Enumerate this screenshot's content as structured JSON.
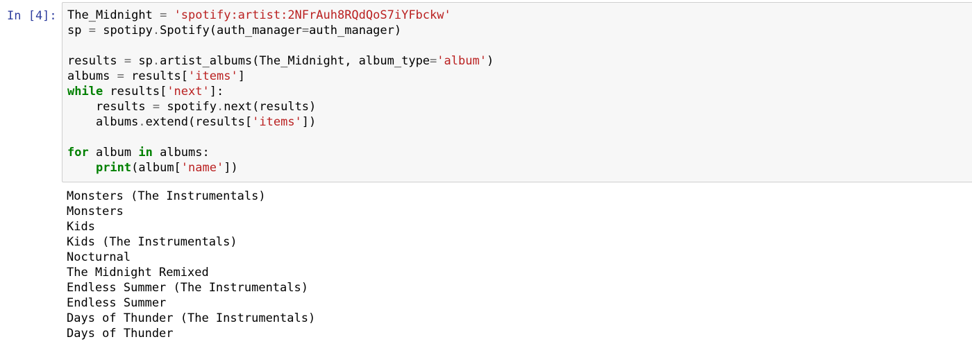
{
  "cell": {
    "prompt": "In [4]:",
    "code_lines": [
      [
        {
          "t": "The_Midnight ",
          "c": ""
        },
        {
          "t": "=",
          "c": "op"
        },
        {
          "t": " ",
          "c": ""
        },
        {
          "t": "'spotify:artist:2NFrAuh8RQdQoS7iYFbckw'",
          "c": "str"
        }
      ],
      [
        {
          "t": "sp ",
          "c": ""
        },
        {
          "t": "=",
          "c": "op"
        },
        {
          "t": " spotipy",
          "c": ""
        },
        {
          "t": ".",
          "c": "op"
        },
        {
          "t": "Spotify(auth_manager",
          "c": ""
        },
        {
          "t": "=",
          "c": "op"
        },
        {
          "t": "auth_manager)",
          "c": ""
        }
      ],
      [],
      [
        {
          "t": "results ",
          "c": ""
        },
        {
          "t": "=",
          "c": "op"
        },
        {
          "t": " sp",
          "c": ""
        },
        {
          "t": ".",
          "c": "op"
        },
        {
          "t": "artist_albums(The_Midnight, album_type",
          "c": ""
        },
        {
          "t": "=",
          "c": "op"
        },
        {
          "t": "'album'",
          "c": "str"
        },
        {
          "t": ")",
          "c": ""
        }
      ],
      [
        {
          "t": "albums ",
          "c": ""
        },
        {
          "t": "=",
          "c": "op"
        },
        {
          "t": " results[",
          "c": ""
        },
        {
          "t": "'items'",
          "c": "str"
        },
        {
          "t": "]",
          "c": ""
        }
      ],
      [
        {
          "t": "while",
          "c": "kw"
        },
        {
          "t": " results[",
          "c": ""
        },
        {
          "t": "'next'",
          "c": "str"
        },
        {
          "t": "]:",
          "c": ""
        }
      ],
      [
        {
          "t": "    results ",
          "c": ""
        },
        {
          "t": "=",
          "c": "op"
        },
        {
          "t": " spotify",
          "c": ""
        },
        {
          "t": ".",
          "c": "op"
        },
        {
          "t": "next(results)",
          "c": ""
        }
      ],
      [
        {
          "t": "    albums",
          "c": ""
        },
        {
          "t": ".",
          "c": "op"
        },
        {
          "t": "extend(results[",
          "c": ""
        },
        {
          "t": "'items'",
          "c": "str"
        },
        {
          "t": "])",
          "c": ""
        }
      ],
      [],
      [
        {
          "t": "for",
          "c": "kw"
        },
        {
          "t": " album ",
          "c": ""
        },
        {
          "t": "in",
          "c": "kw"
        },
        {
          "t": " albums:",
          "c": ""
        }
      ],
      [
        {
          "t": "    ",
          "c": ""
        },
        {
          "t": "print",
          "c": "kw"
        },
        {
          "t": "(album[",
          "c": ""
        },
        {
          "t": "'name'",
          "c": "str"
        },
        {
          "t": "])",
          "c": ""
        }
      ]
    ],
    "output_lines": [
      "Monsters (The Instrumentals)",
      "Monsters",
      "Kids",
      "Kids (The Instrumentals)",
      "Nocturnal",
      "The Midnight Remixed",
      "Endless Summer (The Instrumentals)",
      "Endless Summer",
      "Days of Thunder (The Instrumentals)",
      "Days of Thunder"
    ]
  },
  "colors": {
    "prompt": "#303F9F",
    "keyword": "#008000",
    "string": "#BA2121",
    "operator": "#666666",
    "input_background": "#f7f7f7",
    "input_border": "#cfcfcf"
  }
}
